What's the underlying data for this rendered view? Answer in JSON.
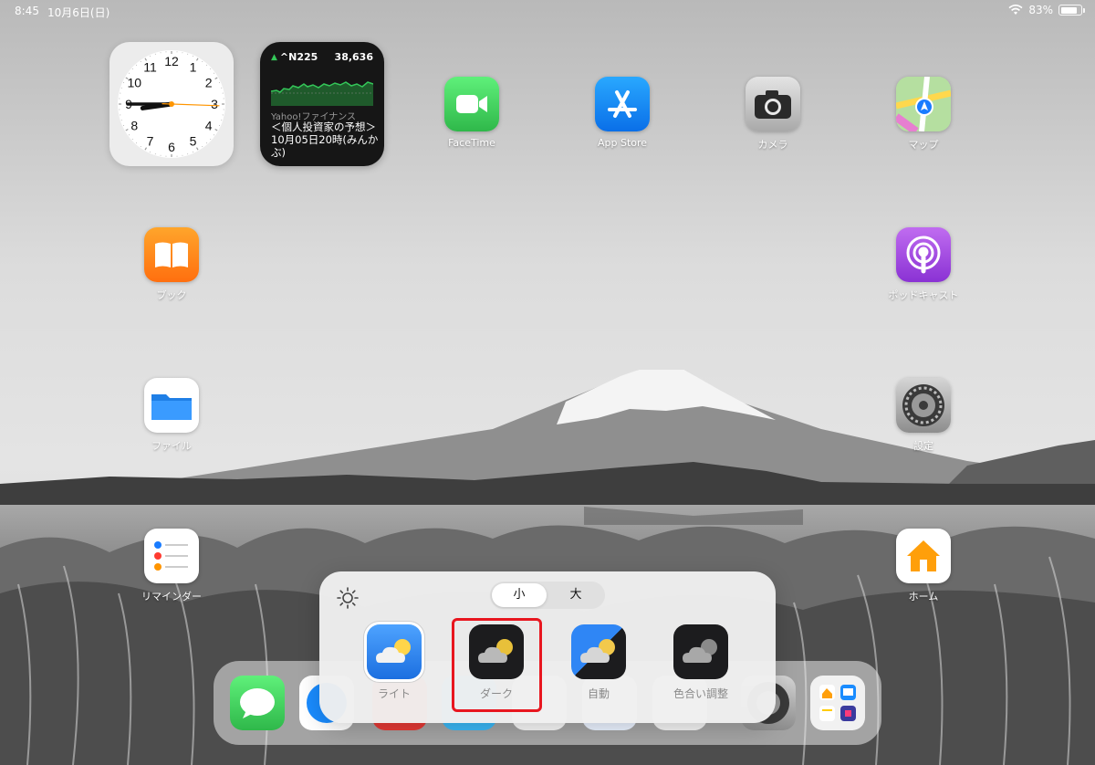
{
  "status_bar": {
    "time": "8:45",
    "date": "10月6日(日)",
    "battery": "83%",
    "battery_level": 0.83
  },
  "widgets": {
    "clock": {
      "numbers": [
        "12",
        "1",
        "2",
        "3",
        "4",
        "5",
        "6",
        "7",
        "8",
        "9",
        "10",
        "11"
      ]
    },
    "stock": {
      "ticker": "^N225",
      "value": "38,636",
      "source": "Yahoo!ファイナンス",
      "headline": "＜個人投資家の予想＞ 10月05日20時(みんかぶ)"
    }
  },
  "apps": {
    "facetime": "FaceTime",
    "appstore": "App Store",
    "camera": "カメラ",
    "maps": "マップ",
    "books": "ブック",
    "podcasts": "ポッドキャスト",
    "files": "ファイル",
    "settings": "設定",
    "reminders": "リマインダー",
    "home": "ホーム"
  },
  "popup": {
    "size_options": [
      "小",
      "大"
    ],
    "selected_size": "小",
    "styles": [
      "ライト",
      "ダーク",
      "自動",
      "色合い調整"
    ],
    "highlighted_style": "ダーク"
  },
  "colors": {
    "highlight": "#e8161f",
    "facetime": "#34c759",
    "appstore": "#1a8cff",
    "books": "#ff8a00",
    "podcasts": "#a146e0"
  }
}
